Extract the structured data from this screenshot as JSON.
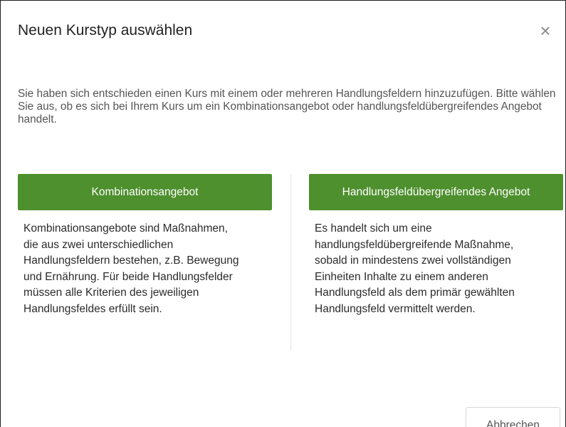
{
  "dialog": {
    "title": "Neuen Kurstyp auswählen",
    "close_symbol": "×",
    "close_icon": "close-icon",
    "intro": "Sie haben sich entschieden einen Kurs mit einem oder mehreren Handlungsfeldern hinzuzufügen. Bitte wählen Sie aus, ob es sich bei Ihrem Kurs um ein Kombinationsangebot oder handlungsfeldübergreifendes Angebot handelt."
  },
  "options": [
    {
      "label": "Kombinationsangebot",
      "description_lines": [
        "Kombinationsangebote sind Maßnahmen,",
        "die aus zwei unterschiedlichen",
        "Handlungsfeldern bestehen, z.B. Bewegung",
        "und Ernährung. Für beide Handlungsfelder",
        "müssen alle Kriterien des jeweiligen",
        "Handlungsfeldes erfüllt sein."
      ]
    },
    {
      "label": "Handlungsfeldübergreifendes Angebot",
      "description_lines": [
        "Es handelt sich um eine",
        "handlungsfeldübergreifende Maßnahme,",
        "sobald in mindestens zwei vollständigen",
        "Einheiten Inhalte zu einem anderen",
        "Handlungsfeld als dem primär gewählten",
        "Handlungsfeld vermittelt werden."
      ]
    }
  ],
  "footer": {
    "cancel_label": "Abbrechen"
  },
  "colors": {
    "primary_button": "#4e8f2e",
    "primary_button_text": "#ffffff"
  }
}
